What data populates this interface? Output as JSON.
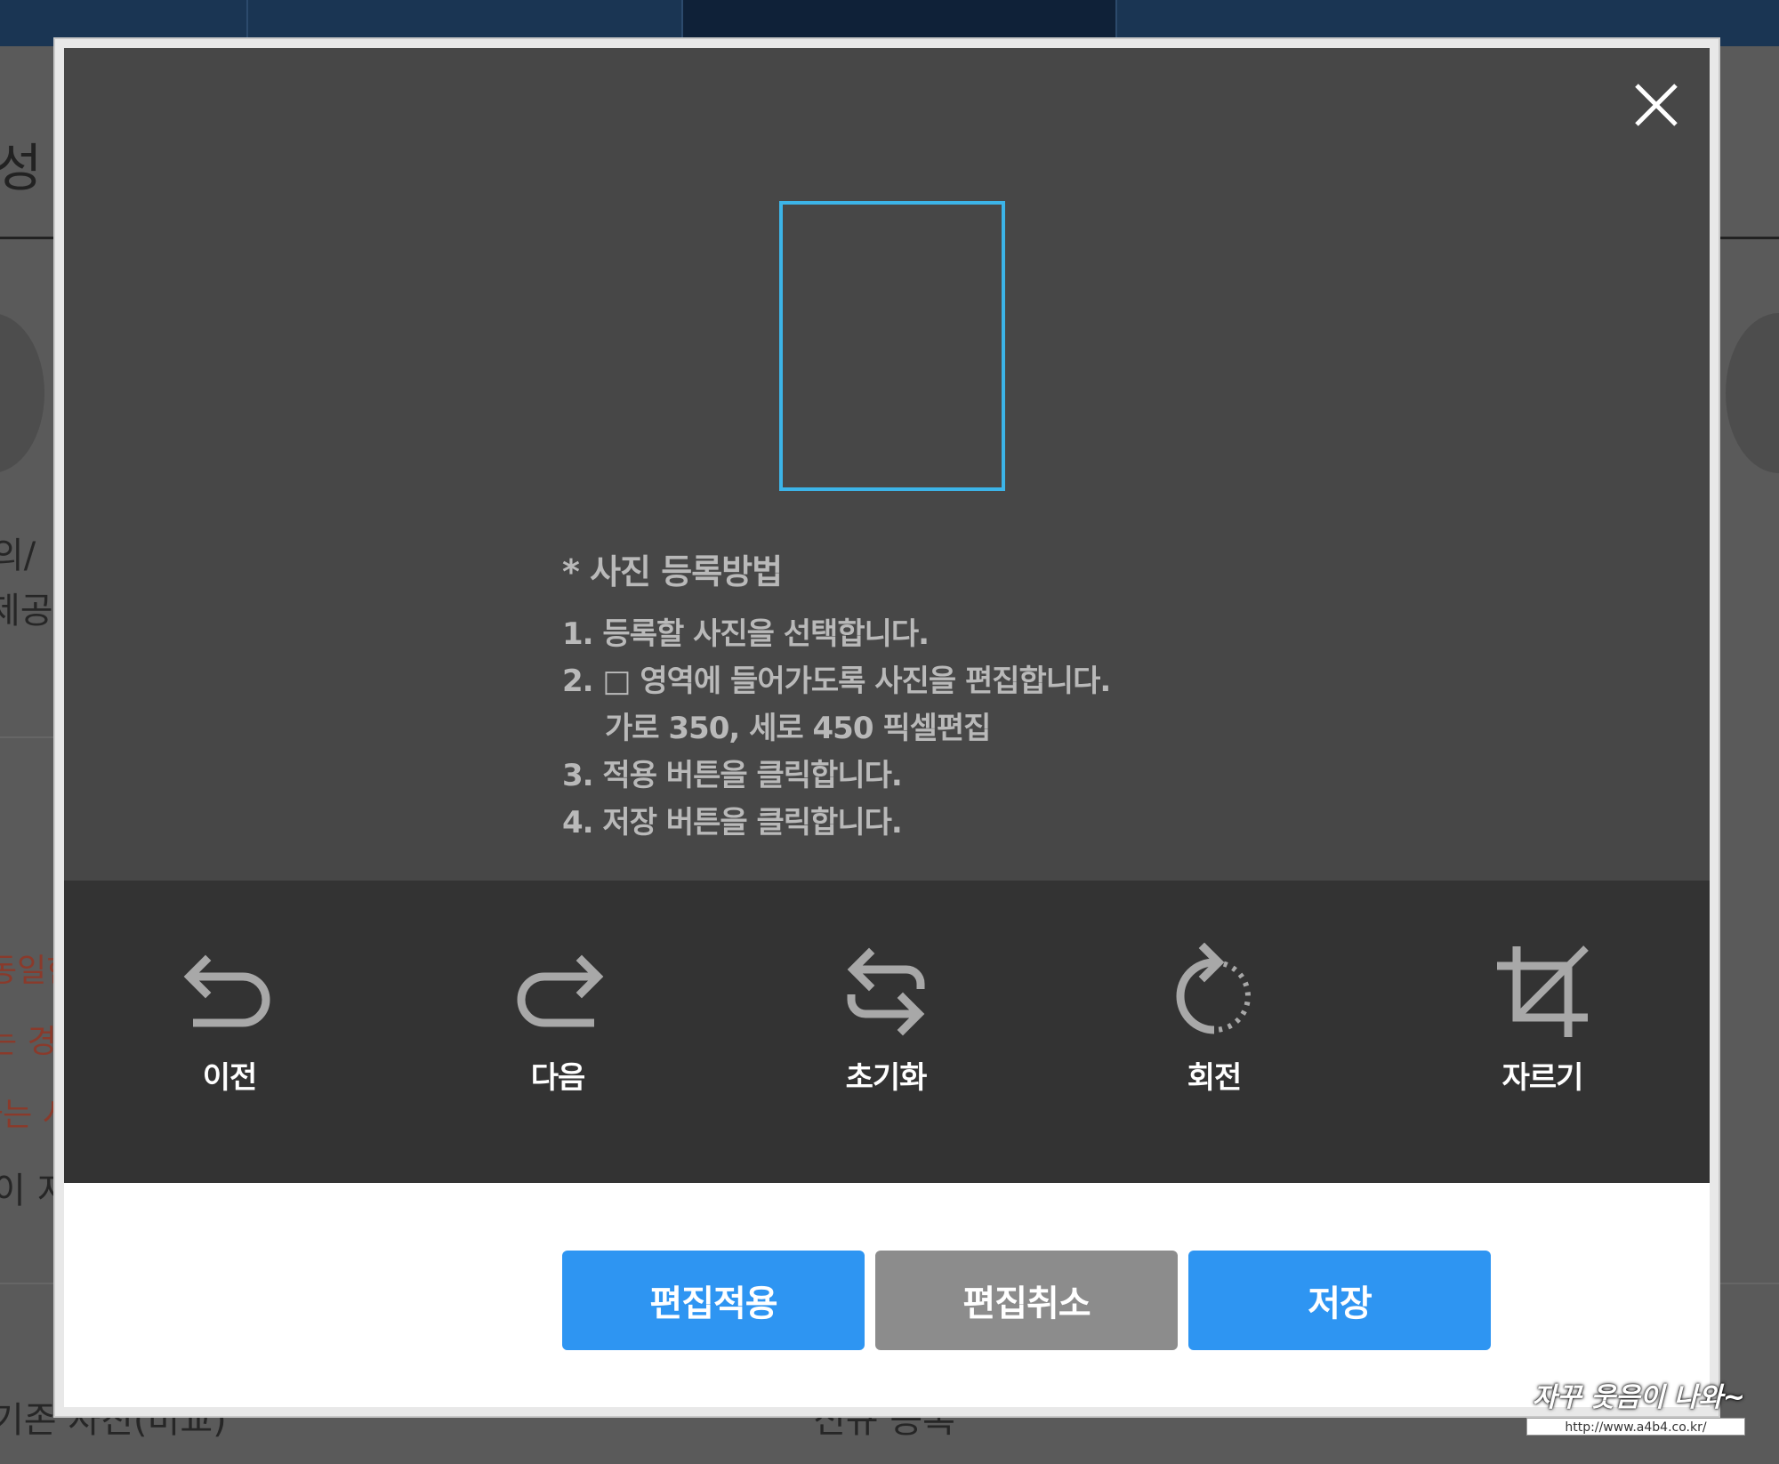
{
  "background_page": {
    "fragments": {
      "left_title_frag": "성",
      "left_line1": "의/",
      "left_line2": "제공",
      "red_line1": "동일한",
      "red_line2": "는 경",
      "red_line3": "하는 시",
      "left_line3": "이 지",
      "bottom_left": "기존 사진(비교)",
      "bottom_right": "신규 등록"
    }
  },
  "modal": {
    "close_icon": "close-icon",
    "instructions": {
      "title": "* 사진 등록방법",
      "steps": [
        "1. 등록할 사진을 선택합니다.",
        "2. □ 영역에 들어가도록 사진을 편집합니다.",
        "가로 350, 세로 450 픽셀편집",
        "3. 적용 버튼을 클릭합니다.",
        "4. 저장 버튼을 클릭합니다."
      ]
    },
    "toolbar": {
      "tools": [
        {
          "label": "이전",
          "icon": "undo-icon"
        },
        {
          "label": "다음",
          "icon": "redo-icon"
        },
        {
          "label": "초기화",
          "icon": "reset-icon"
        },
        {
          "label": "회전",
          "icon": "rotate-icon"
        },
        {
          "label": "자르기",
          "icon": "crop-icon"
        }
      ]
    },
    "buttons": {
      "apply": "편집적용",
      "cancel": "편집취소",
      "save": "저장"
    },
    "colors": {
      "accent": "#2e95f2",
      "crop_frame": "#3cb4e8",
      "cancel": "#8c8c8c"
    }
  },
  "watermark": {
    "text": "자꾸 웃음이 나와~",
    "url": "http://www.a4b4.co.kr/"
  }
}
